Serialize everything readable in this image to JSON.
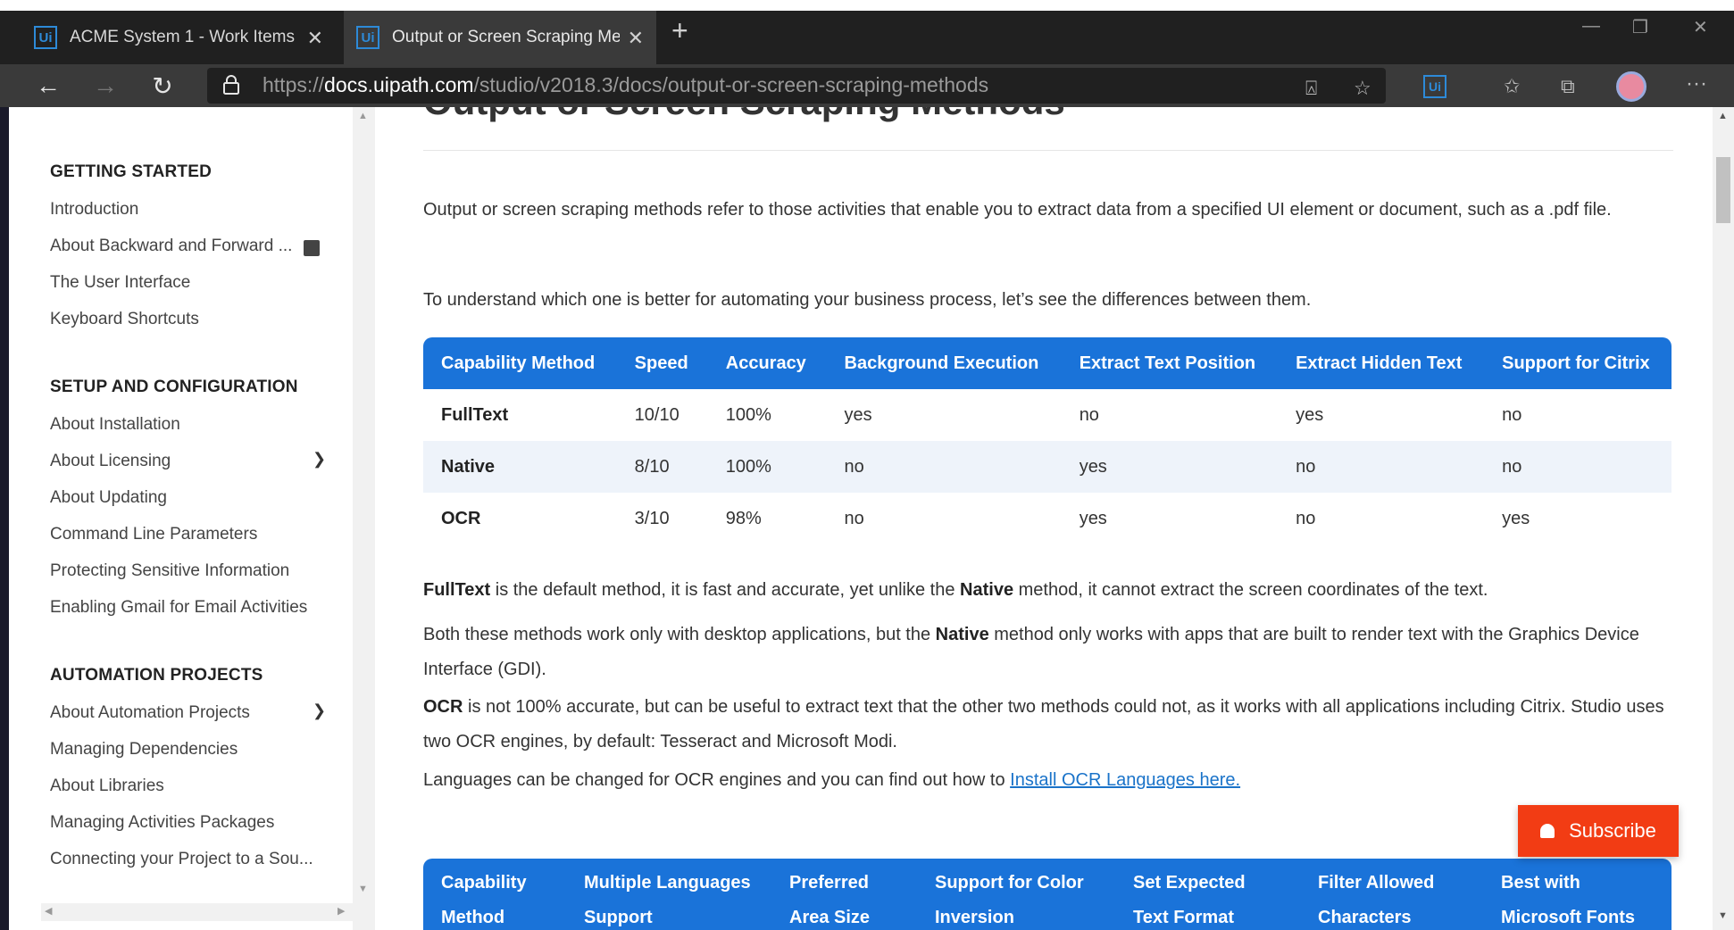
{
  "tabs": [
    {
      "title": "ACME System 1 - Work Items",
      "icon": "uipath-icon",
      "close": "✕"
    },
    {
      "title": "Output or Screen Scraping Meth",
      "icon": "uipath-icon",
      "close": "✕"
    }
  ],
  "new_tab": "+",
  "address": {
    "scheme": "https://",
    "host": "docs.uipath.com",
    "path": "/studio/v2018.3/docs/output-or-screen-scraping-methods"
  },
  "sidebar": {
    "sections": [
      {
        "title": "GETTING STARTED",
        "items": [
          "Introduction",
          "About Backward and Forward ...",
          "The User Interface",
          "Keyboard Shortcuts"
        ]
      },
      {
        "title": "SETUP AND CONFIGURATION",
        "items": [
          "About Installation",
          "About Licensing",
          "About Updating",
          "Command Line Parameters",
          "Protecting Sensitive Information",
          "Enabling Gmail for Email Activities"
        ]
      },
      {
        "title": "AUTOMATION PROJECTS",
        "items": [
          "About Automation Projects",
          "Managing Dependencies",
          "About Libraries",
          "Managing Activities Packages",
          "Connecting your Project to a Sou..."
        ]
      }
    ]
  },
  "content": {
    "title": "Output or Screen Scraping Methods",
    "intro": "Output or screen scraping methods refer to those activities that enable you to extract data from a specified UI element or document, such as a .pdf file.",
    "intro2": "To understand which one is better for automating your business process, let’s see the differences between them.",
    "table1": {
      "headers": [
        "Capability Method",
        "Speed",
        "Accuracy",
        "Background Execution",
        "Extract Text Position",
        "Extract Hidden Text",
        "Support for Citrix"
      ],
      "rows": [
        [
          "FullText",
          "10/10",
          "100%",
          "yes",
          "no",
          "yes",
          "no"
        ],
        [
          "Native",
          "8/10",
          "100%",
          "no",
          "yes",
          "no",
          "no"
        ],
        [
          "OCR",
          "3/10",
          "98%",
          "no",
          "yes",
          "no",
          "yes"
        ]
      ]
    },
    "p_fulltext": {
      "b1": "FullText",
      "t1": " is the default method, it is fast and accurate, yet unlike the ",
      "b2": "Native",
      "t2": " method, it cannot extract the screen coordinates of the text."
    },
    "p_both": {
      "t1": "Both these methods work only with desktop applications, but the ",
      "b1": "Native",
      "t2": " method only works with apps that are built to render text with the Graphics Device Interface (GDI)."
    },
    "p_ocr": {
      "b1": "OCR",
      "t1": " is not 100% accurate, but can be useful to extract text that the other two methods could not, as it works with all applications including Citrix. Studio uses two OCR engines, by default: Tesseract and Microsoft Modi."
    },
    "p_lang": {
      "t1": "Languages can be changed for OCR engines and you can find out how to ",
      "link": "Install OCR Languages here."
    },
    "table2": {
      "headers": [
        "Capability Method",
        "Multiple Languages Support",
        "Preferred Area Size",
        "Support for Color Inversion",
        "Set Expected Text Format",
        "Filter Allowed Characters",
        "Best with Microsoft Fonts"
      ]
    }
  },
  "subscribe_label": "Subscribe",
  "colors": {
    "accent": "#1a73d9",
    "subscribe": "#f23c14",
    "chrome": "#202020"
  }
}
